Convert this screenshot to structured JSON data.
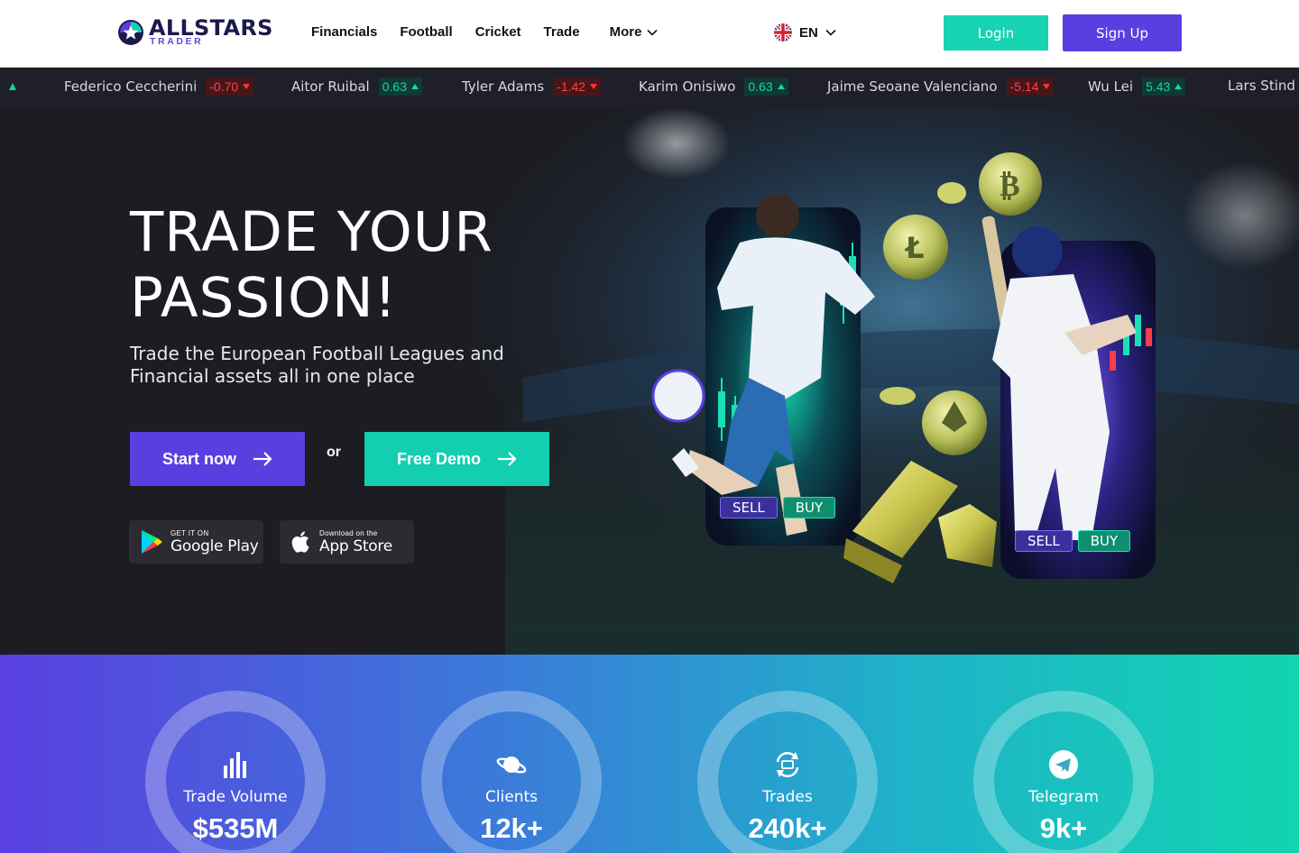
{
  "brand": {
    "name": "ALLSTARS",
    "sub": "TRADER",
    "colors": {
      "primary": "#5a3fe0",
      "accent": "#13cfb0",
      "navy": "#1b1a4b"
    }
  },
  "nav": {
    "items": [
      "Financials",
      "Football",
      "Cricket",
      "Trade"
    ],
    "more_label": "More",
    "language": "EN"
  },
  "auth": {
    "login_label": "Login",
    "signup_label": "Sign Up"
  },
  "ticker": [
    {
      "name": "Federico Ceccherini",
      "value": "-0.70",
      "direction": "down"
    },
    {
      "name": "Aitor Ruibal",
      "value": "0.63",
      "direction": "up"
    },
    {
      "name": "Tyler Adams",
      "value": "-1.42",
      "direction": "down"
    },
    {
      "name": "Karim Onisiwo",
      "value": "0.63",
      "direction": "up"
    },
    {
      "name": "Jaime Seoane Valenciano",
      "value": "-5.14",
      "direction": "down"
    },
    {
      "name": "Wu Lei",
      "value": "5.43",
      "direction": "up"
    },
    {
      "name": "Lars Stind",
      "value": "",
      "direction": ""
    }
  ],
  "hero": {
    "title_line1": "TRADE YOUR",
    "title_line2": "PASSION!",
    "subtitle": "Trade the European Football Leagues and Financial assets all in one place",
    "start_label": "Start now",
    "or_label": "or",
    "demo_label": "Free Demo",
    "google_small": "GET IT ON",
    "google_big": "Google Play",
    "apple_small": "Download on the",
    "apple_big": "App Store",
    "phone1": {
      "sell": "SELL",
      "buy": "BUY"
    },
    "phone2": {
      "sell": "SELL",
      "buy": "BUY"
    }
  },
  "stats": [
    {
      "label": "Trade Volume",
      "value": "$535M",
      "icon": "bar-chart-icon"
    },
    {
      "label": "Clients",
      "value": "12k+",
      "icon": "planet-icon"
    },
    {
      "label": "Trades",
      "value": "240k+",
      "icon": "exchange-icon"
    },
    {
      "label": "Telegram",
      "value": "9k+",
      "icon": "telegram-icon"
    }
  ]
}
